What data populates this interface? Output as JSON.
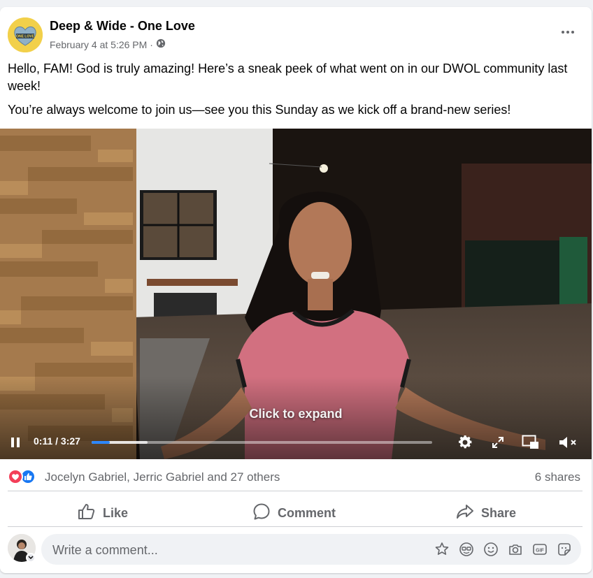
{
  "post": {
    "page_name": "Deep & Wide - One Love",
    "timestamp": "February 4 at 5:26 PM",
    "privacy_icon": "globe-icon",
    "avatar_text": "ONE LOVE",
    "paragraphs": [
      "Hello, FAM! God is truly amazing! Here’s a sneak peek of what went on in our DWOL community last week!",
      "You’re always welcome to join us—see you this Sunday as we kick off a brand-new series!"
    ]
  },
  "video": {
    "overlay_label": "Click to expand",
    "time": "0:11 / 3:27",
    "played_fraction": 0.053,
    "buffered_fraction": 0.165,
    "controls": [
      "pause-icon",
      "settings-icon",
      "fullscreen-icon",
      "miniplayer-icon",
      "muted-volume-icon"
    ]
  },
  "engagement": {
    "reaction_icons": [
      "love-reaction-icon",
      "like-reaction-icon"
    ],
    "names": "Jocelyn Gabriel, Jerric Gabriel and 27 others",
    "shares": "6 shares"
  },
  "actions": {
    "like": "Like",
    "comment": "Comment",
    "share": "Share"
  },
  "comment_box": {
    "placeholder": "Write a comment...",
    "icons": [
      "avatar-sticker-icon",
      "frame-icon",
      "emoji-icon",
      "camera-icon",
      "gif-icon",
      "sticker-icon"
    ],
    "gif_text": "GIF"
  },
  "colors": {
    "accent": "#1877f2",
    "love": "#f33e58",
    "secondary_text": "#65676b"
  }
}
